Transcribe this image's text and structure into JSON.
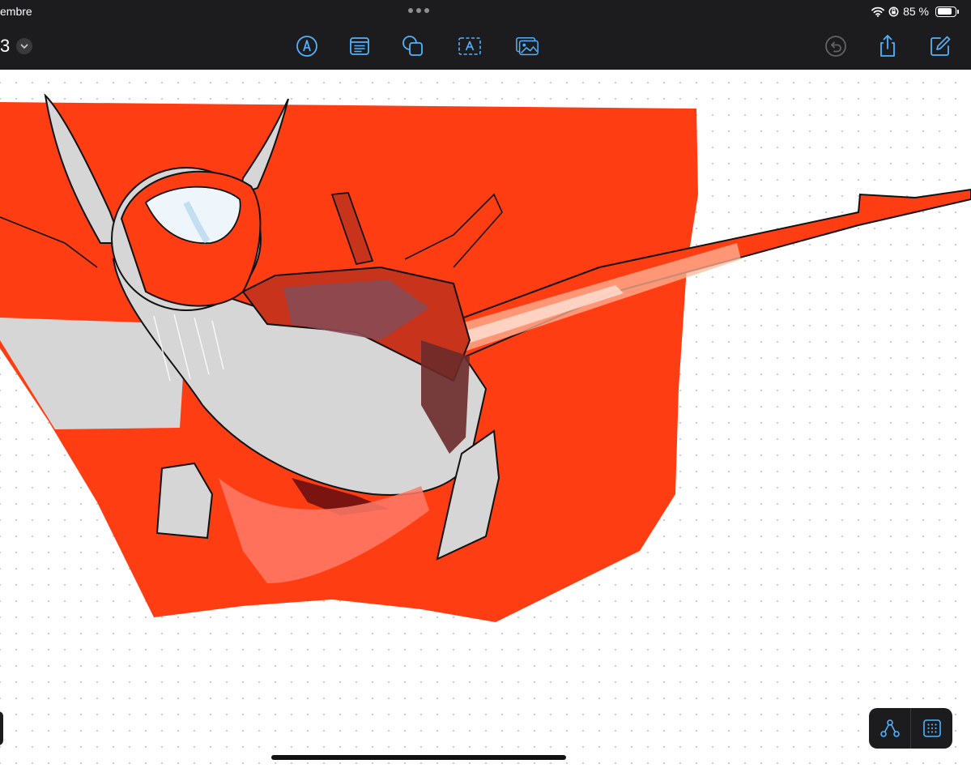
{
  "status_bar": {
    "date": "embre",
    "battery_text": "85 %",
    "battery_level": 0.85
  },
  "toolbar": {
    "doc_title": "3",
    "tools": [
      {
        "name": "pen-tool-icon"
      },
      {
        "name": "sticky-note-icon"
      },
      {
        "name": "shapes-icon"
      },
      {
        "name": "text-box-icon"
      },
      {
        "name": "media-icon"
      }
    ],
    "right": [
      {
        "name": "undo-icon",
        "enabled": false
      },
      {
        "name": "share-icon",
        "enabled": true
      },
      {
        "name": "new-board-icon",
        "enabled": true
      }
    ]
  },
  "canvas": {
    "grid": "dots",
    "artwork": "drawing-sketch"
  },
  "bottom_tools": [
    {
      "name": "connector-icon"
    },
    {
      "name": "grid-toggle-icon"
    }
  ],
  "colors": {
    "accent": "#4fb3ff",
    "toolbar_bg": "#1c1c1e",
    "art_red": "#ff3d12",
    "art_gray": "#d6d6d6"
  }
}
